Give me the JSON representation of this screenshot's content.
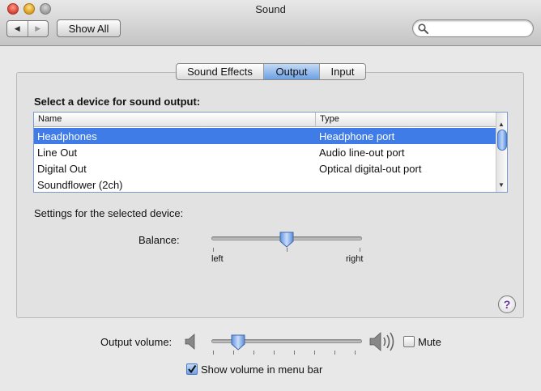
{
  "window": {
    "title": "Sound"
  },
  "toolbar": {
    "back_glyph": "◀",
    "forward_glyph": "▶",
    "show_all_label": "Show All",
    "search_value": "",
    "search_placeholder": ""
  },
  "tabs": [
    {
      "label": "Sound Effects",
      "selected": false
    },
    {
      "label": "Output",
      "selected": true
    },
    {
      "label": "Input",
      "selected": false
    }
  ],
  "output": {
    "select_label": "Select a device for sound output:",
    "columns": {
      "name": "Name",
      "type": "Type"
    },
    "devices": [
      {
        "name": "Headphones",
        "type": "Headphone port",
        "selected": true
      },
      {
        "name": "Line Out",
        "type": "Audio line-out port",
        "selected": false
      },
      {
        "name": "Digital Out",
        "type": "Optical digital-out port",
        "selected": false
      },
      {
        "name": "Soundflower (2ch)",
        "type": "",
        "selected": false
      }
    ],
    "settings_label": "Settings for the selected device:",
    "balance_label": "Balance:",
    "balance_left": "left",
    "balance_right": "right",
    "balance_value": 0.5
  },
  "help_glyph": "?",
  "volume": {
    "label": "Output volume:",
    "value": 0.18,
    "mute_label": "Mute",
    "mute_checked": false,
    "show_in_menubar_label": "Show volume in menu bar",
    "show_in_menubar_checked": true
  },
  "colors": {
    "selection": "#3f7ce8",
    "selected_tab": "#6da0e3",
    "help": "#6c2fa5"
  }
}
